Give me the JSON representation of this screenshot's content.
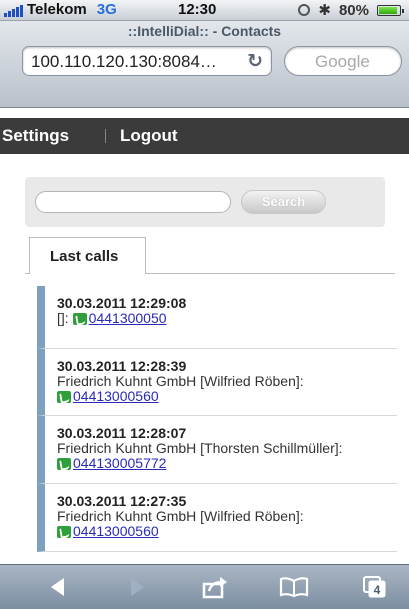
{
  "status_bar": {
    "carrier": "Telekom",
    "network": "3G",
    "time": "12:30",
    "battery": "80%"
  },
  "browser": {
    "page_title": "::IntelliDial:: - Contacts",
    "url": "100.110.120.130:8084…",
    "search_placeholder": "Google"
  },
  "nav": {
    "settings": "Settings",
    "logout": "Logout"
  },
  "search_form": {
    "input_value": "",
    "button_label": "Search"
  },
  "tabs": [
    {
      "label": "Last calls"
    }
  ],
  "calls": [
    {
      "datetime": "30.03.2011 12:29:08",
      "contact": "[]:",
      "number": "0441300050"
    },
    {
      "datetime": "30.03.2011 12:28:39",
      "contact": "Friedrich Kuhnt GmbH [Wilfried Röben]:",
      "number": "04413000560"
    },
    {
      "datetime": "30.03.2011 12:28:07",
      "contact": "Friedrich Kuhnt GmbH [Thorsten Schillmüller]:",
      "number": "044130005772"
    },
    {
      "datetime": "30.03.2011 12:27:35",
      "contact": "Friedrich Kuhnt GmbH [Wilfried Röben]:",
      "number": "04413000560"
    }
  ],
  "toolbar": {
    "tabs_count": "4",
    "icons": [
      "back-icon",
      "forward-icon",
      "share-icon",
      "bookmarks-icon",
      "pages-icon"
    ]
  },
  "colors": {
    "nav_bg": "#3b3b3b",
    "accent_bar": "#7f9fbe",
    "link": "#2a2ab8",
    "phone_icon": "#2e9f3a"
  }
}
